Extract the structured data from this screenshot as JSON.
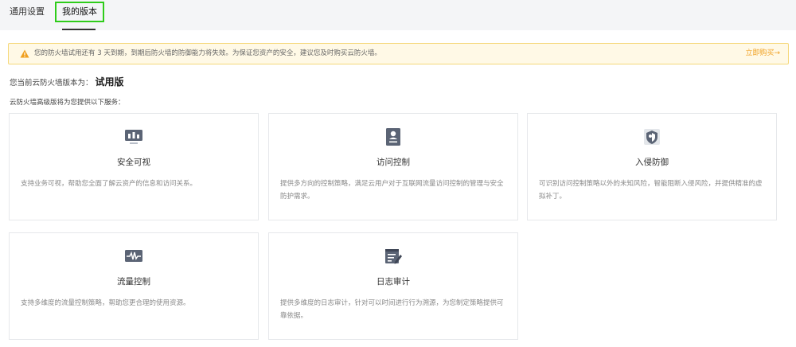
{
  "tabs": {
    "general": "通用设置",
    "version": "我的版本"
  },
  "alert": {
    "text": "您的防火墙试用还有 3 天到期，到期后防火墙的防御能力将失效。为保证您资产的安全，建议您及时购买云防火墙。",
    "action": "立即购买→"
  },
  "version": {
    "label": "您当前云防火墙版本为：",
    "value": "试用版"
  },
  "services_intro": "云防火墙高级版将为您提供以下服务：",
  "cards": [
    {
      "title": "安全可视",
      "desc": "支持业务可视，帮助您全面了解云资产的信息和访问关系。",
      "icon": "monitor-chart-icon"
    },
    {
      "title": "访问控制",
      "desc": "提供多方向的控制策略，满足云用户对于互联网流量访问控制的管理与安全防护需求。",
      "icon": "id-card-icon"
    },
    {
      "title": "入侵防御",
      "desc": "可识别访问控制策略以外的未知风险，智能阻断入侵风险，并提供精准的虚拟补丁。",
      "icon": "shield-icon"
    },
    {
      "title": "流量控制",
      "desc": "支持多维度的流量控制策略，帮助您更合理的使用资源。",
      "icon": "waveform-icon"
    },
    {
      "title": "日志审计",
      "desc": "提供多维度的日志审计，针对可以时间进行行为溯源，为您制定策略提供可靠依据。",
      "icon": "edit-document-icon"
    }
  ],
  "colors": {
    "tab_highlight": "#2ecc1a",
    "alert_background": "#fff9e6",
    "alert_border": "#f5d87a",
    "alert_link": "#f0a020",
    "icon": "#5b6475"
  }
}
